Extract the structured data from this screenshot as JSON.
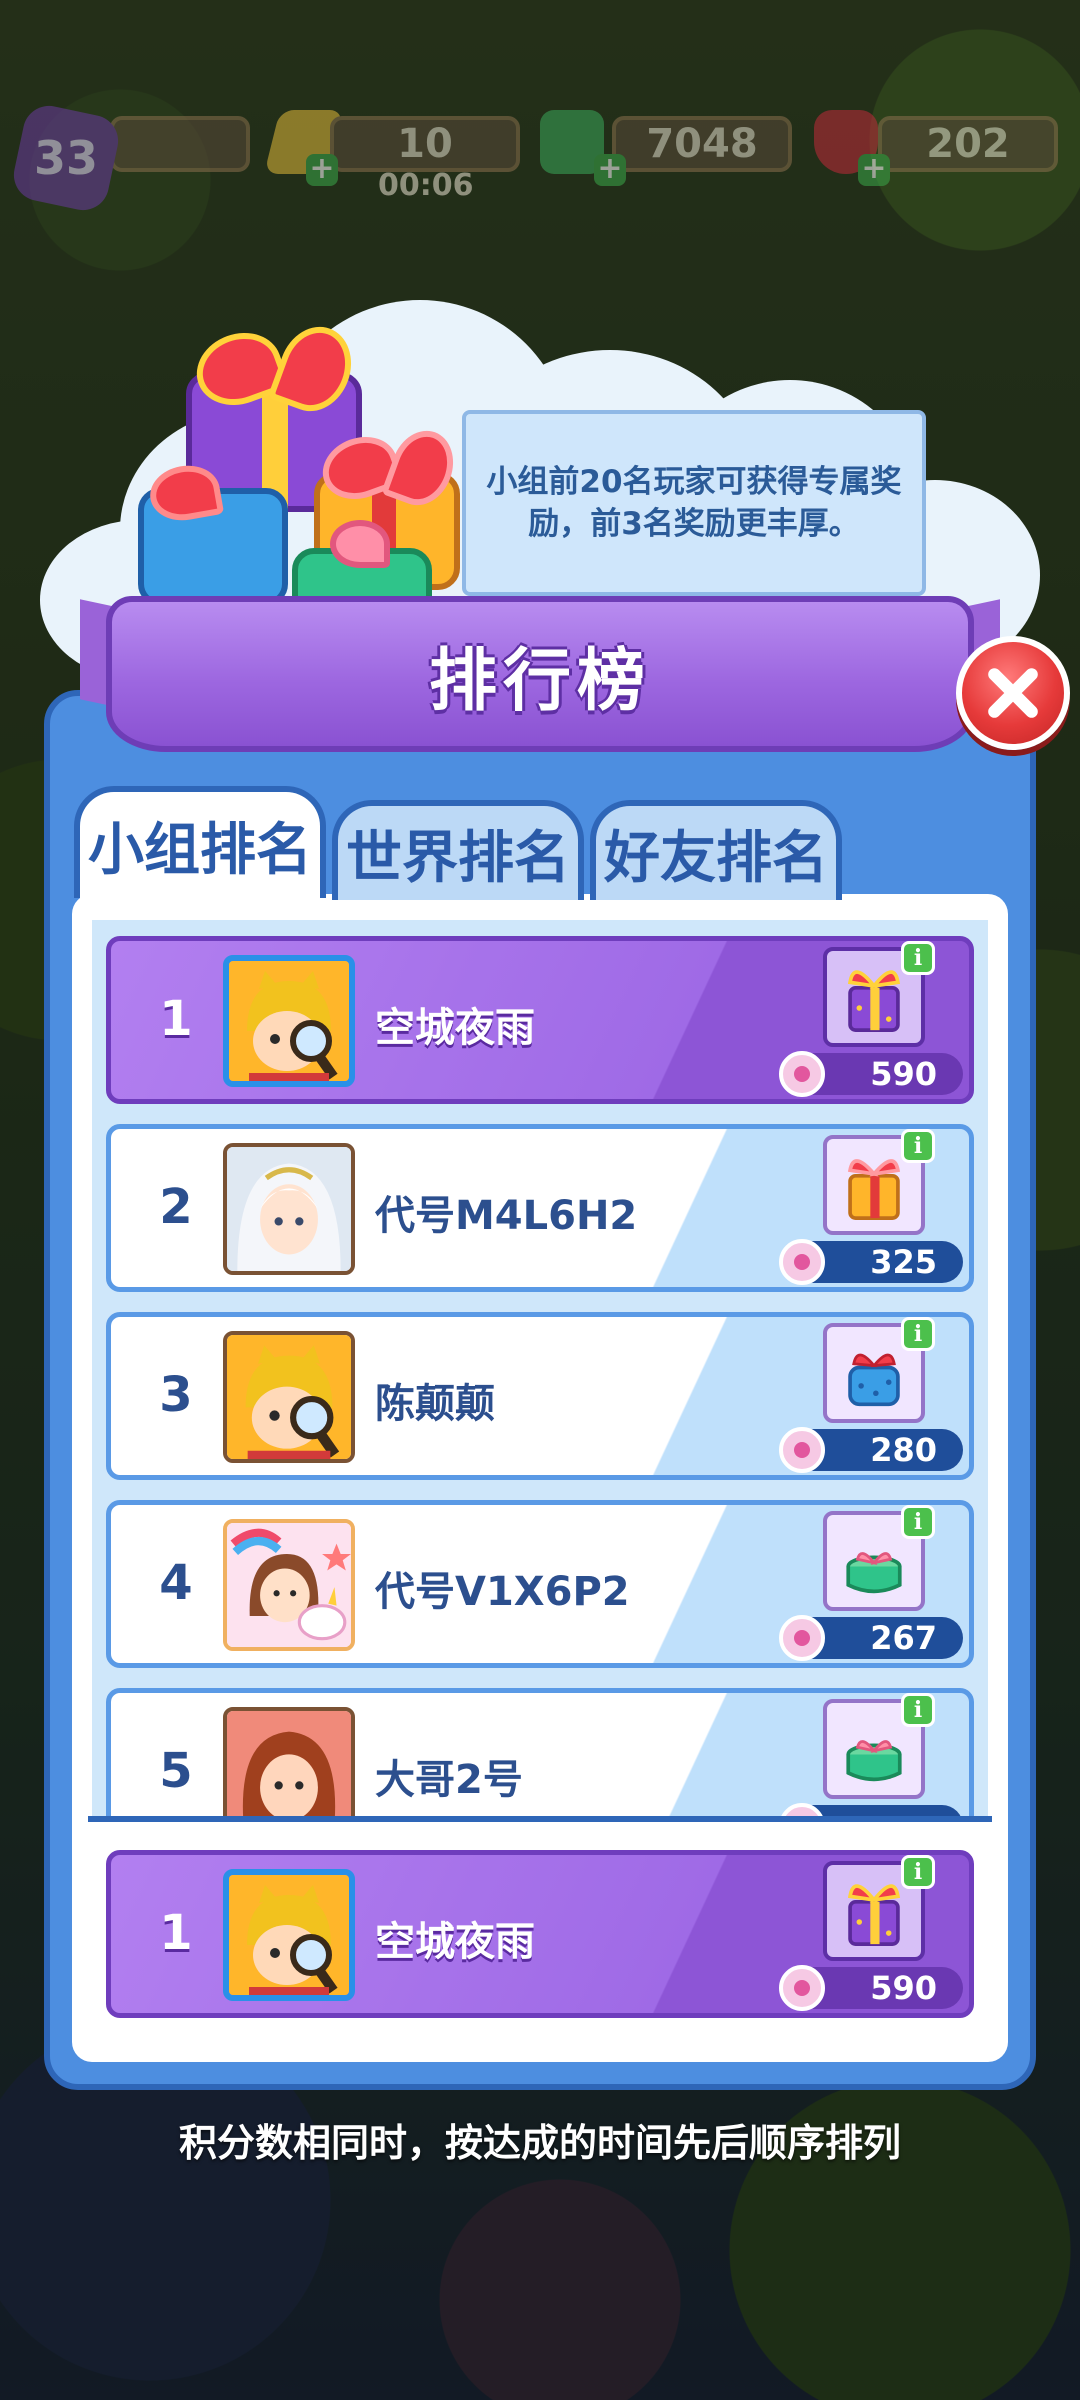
{
  "hud": {
    "level": "33",
    "energy": "10",
    "energy_timer": "00:06",
    "cash": "7048",
    "gems": "202"
  },
  "tip": {
    "text": "小组前20名玩家可获得专属奖励，前3名奖励更丰厚。"
  },
  "panel": {
    "title": "排行榜",
    "tabs": [
      {
        "label": "小组排名",
        "active": true
      },
      {
        "label": "世界排名",
        "active": false
      },
      {
        "label": "好友排名",
        "active": false
      }
    ]
  },
  "leaderboard": [
    {
      "rank": "1",
      "name": "空城夜雨",
      "score": "590",
      "avatar": "detective-boy-avatar",
      "gift": "purple-gift-icon"
    },
    {
      "rank": "2",
      "name": "代号M4L6H2",
      "score": "325",
      "avatar": "white-hair-avatar",
      "gift": "orange-gift-icon"
    },
    {
      "rank": "3",
      "name": "陈颠颠",
      "score": "280",
      "avatar": "detective-boy-avatar",
      "gift": "blue-gift-icon"
    },
    {
      "rank": "4",
      "name": "代号V1X6P2",
      "score": "267",
      "avatar": "unicorn-girl-avatar",
      "gift": "green-gift-icon"
    },
    {
      "rank": "5",
      "name": "大哥2号",
      "score": "",
      "avatar": "red-hair-woman-avatar",
      "gift": "green-gift-icon"
    }
  ],
  "my_rank": {
    "rank": "1",
    "name": "空城夜雨",
    "score": "590"
  },
  "footer_note": "积分数相同时，按达成的时间先后顺序排列",
  "colors": {
    "panel_blue": "#4d8ee0",
    "banner_purple": "#9d67e0",
    "highlight_row": "#9f6ae6",
    "close_red": "#e63a3a"
  }
}
